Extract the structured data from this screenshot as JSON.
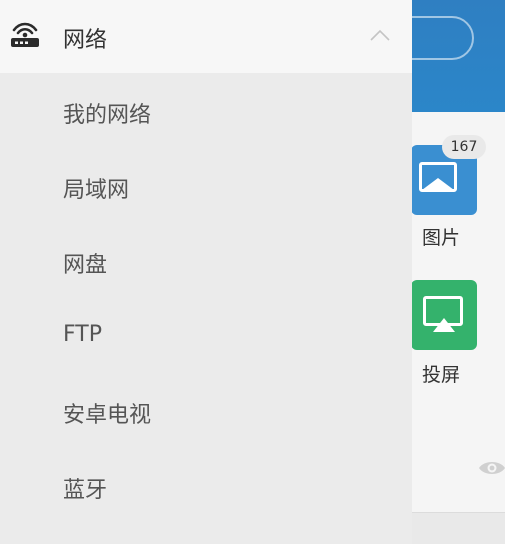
{
  "background_app": {
    "tiles": [
      {
        "label": "图片",
        "badge": "167",
        "icon": "image-icon",
        "color": "#3a8fd1"
      },
      {
        "label": "投屏",
        "icon": "screen-cast-icon",
        "color": "#34b26c"
      }
    ],
    "accent": "#2f7fc2"
  },
  "drawer": {
    "header": {
      "title": "网络",
      "icon": "router-icon",
      "expanded": true
    },
    "items": [
      {
        "label": "我的网络"
      },
      {
        "label": "局域网"
      },
      {
        "label": "网盘"
      },
      {
        "label": "FTP"
      },
      {
        "label": "安卓电视"
      },
      {
        "label": "蓝牙"
      }
    ]
  }
}
